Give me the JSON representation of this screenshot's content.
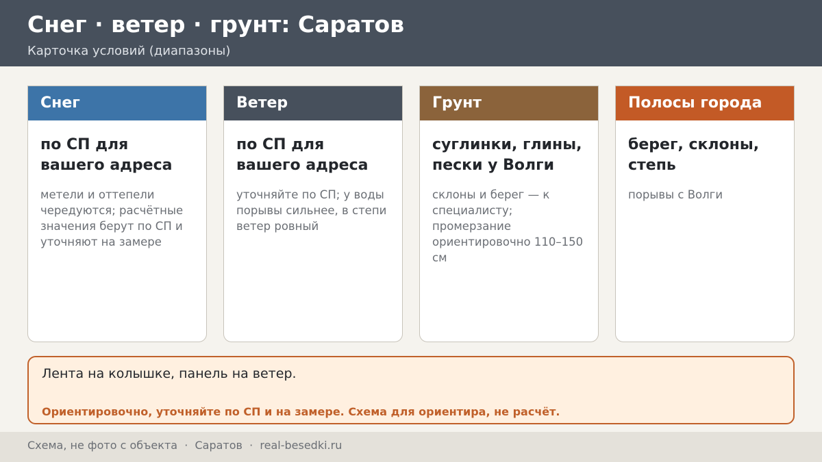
{
  "header": {
    "title": "Снег · ветер · грунт: Саратов",
    "subtitle": "Карточка условий (диапазоны)",
    "background": "#47505c"
  },
  "cards": [
    {
      "title": "Снег",
      "color": "#3d74a8",
      "main": "по СП для вашего адреса",
      "note": "метели и оттепели чередуются; расчётные значения берут по СП и уточняют на замере"
    },
    {
      "title": "Ветер",
      "color": "#47505c",
      "main": "по СП для вашего адреса",
      "note": "уточняйте по СП; у воды порывы сильнее, в степи ветер ровный"
    },
    {
      "title": "Грунт",
      "color": "#8b633b",
      "main": "суглинки, глины, пески у Волги",
      "note": "склоны и берег — к специалисту; промерзание ориентировочно 110–150 см"
    },
    {
      "title": "Полосы города",
      "color": "#c35a26",
      "main": "берег, склоны, степь",
      "note": "порывы с Волги"
    }
  ],
  "note_box": {
    "main": "Лента на колышке, панель на ветер.",
    "warning": "Ориентировочно, уточняйте по СП и на замере. Схема для ориентира, не расчёт.",
    "accent": "#c0602a"
  },
  "footer": {
    "text": "Схема, не фото с объекта  ·  Саратов  ·  real-besedki.ru"
  }
}
